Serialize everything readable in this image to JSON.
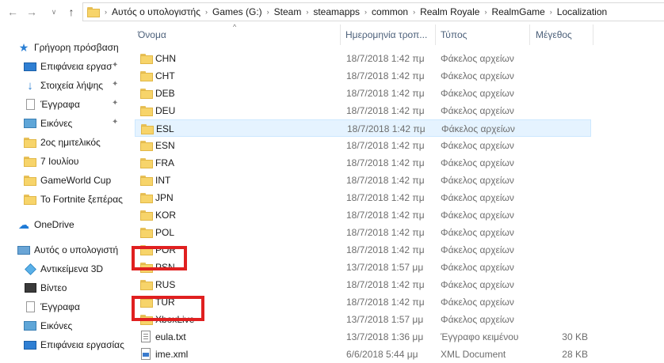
{
  "address": {
    "crumbs": [
      "Αυτός ο υπολογιστής",
      "Games (G:)",
      "Steam",
      "steamapps",
      "common",
      "Realm Royale",
      "RealmGame",
      "Localization"
    ]
  },
  "columns": {
    "name": "Όνομα",
    "date": "Ημερομηνία τροπ...",
    "type": "Τύπος",
    "size": "Μέγεθος"
  },
  "sidebar": {
    "quick_access": "Γρήγορη πρόσβαση",
    "quick_items": [
      "Επιφάνεια εργασ",
      "Στοιχεία λήψης",
      "Έγγραφα",
      "Εικόνες",
      "2ος ημιτελικός",
      "7 Ιουλίου",
      "GameWorld Cup",
      "Το Fortnite ξεπέρας"
    ],
    "onedrive": "OneDrive",
    "this_pc": "Αυτός ο υπολογιστή",
    "pc_items": [
      "Αντικείμενα 3D",
      "Βίντεο",
      "Έγγραφα",
      "Εικόνες",
      "Επιφάνεια εργασίας"
    ]
  },
  "files": [
    {
      "name": "CHN",
      "date": "18/7/2018 1:42 πμ",
      "type": "Φάκελος αρχείων",
      "size": ""
    },
    {
      "name": "CHT",
      "date": "18/7/2018 1:42 πμ",
      "type": "Φάκελος αρχείων",
      "size": ""
    },
    {
      "name": "DEB",
      "date": "18/7/2018 1:42 πμ",
      "type": "Φάκελος αρχείων",
      "size": ""
    },
    {
      "name": "DEU",
      "date": "18/7/2018 1:42 πμ",
      "type": "Φάκελος αρχείων",
      "size": ""
    },
    {
      "name": "ESL",
      "date": "18/7/2018 1:42 πμ",
      "type": "Φάκελος αρχείων",
      "size": ""
    },
    {
      "name": "ESN",
      "date": "18/7/2018 1:42 πμ",
      "type": "Φάκελος αρχείων",
      "size": ""
    },
    {
      "name": "FRA",
      "date": "18/7/2018 1:42 πμ",
      "type": "Φάκελος αρχείων",
      "size": ""
    },
    {
      "name": "INT",
      "date": "18/7/2018 1:42 πμ",
      "type": "Φάκελος αρχείων",
      "size": ""
    },
    {
      "name": "JPN",
      "date": "18/7/2018 1:42 πμ",
      "type": "Φάκελος αρχείων",
      "size": ""
    },
    {
      "name": "KOR",
      "date": "18/7/2018 1:42 πμ",
      "type": "Φάκελος αρχείων",
      "size": ""
    },
    {
      "name": "POL",
      "date": "18/7/2018 1:42 πμ",
      "type": "Φάκελος αρχείων",
      "size": ""
    },
    {
      "name": "POR",
      "date": "18/7/2018 1:42 πμ",
      "type": "Φάκελος αρχείων",
      "size": ""
    },
    {
      "name": "PSN",
      "date": "13/7/2018 1:57 μμ",
      "type": "Φάκελος αρχείων",
      "size": ""
    },
    {
      "name": "RUS",
      "date": "18/7/2018 1:42 πμ",
      "type": "Φάκελος αρχείων",
      "size": ""
    },
    {
      "name": "TUR",
      "date": "18/7/2018 1:42 πμ",
      "type": "Φάκελος αρχείων",
      "size": ""
    },
    {
      "name": "XboxLive",
      "date": "13/7/2018 1:57 μμ",
      "type": "Φάκελος αρχείων",
      "size": ""
    },
    {
      "name": "eula.txt",
      "date": "13/7/2018 1:36 μμ",
      "type": "Έγγραφο κειμένου",
      "size": "30 KB"
    },
    {
      "name": "ime.xml",
      "date": "6/6/2018 5:44 μμ",
      "type": "XML Document",
      "size": "28 KB"
    }
  ],
  "colors": {
    "highlight": "#e02020",
    "selection": "#e5f3ff",
    "folder": "#f7d46a"
  }
}
